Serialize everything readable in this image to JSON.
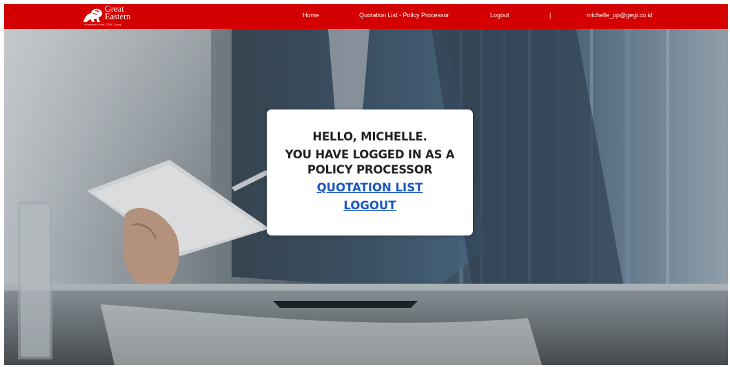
{
  "brand": {
    "logo_line1": "Great",
    "logo_line2": "Eastern",
    "logo_tagline": "A member of the OCBC Group"
  },
  "navbar": {
    "home_label": "Home",
    "quotation_label": "Quotation List - Policy Processor",
    "logout_label": "Logout",
    "separator": "|",
    "user_email": "michelle_pp@gegi.co.id"
  },
  "welcome_card": {
    "greeting": "HELLO, MICHELLE.",
    "role_line1": "YOU HAVE LOGGED IN AS A",
    "role_line2": "POLICY PROCESSOR",
    "quotation_link": "QUOTATION LIST",
    "logout_link": "LOGOUT"
  },
  "colors": {
    "navbar_bg": "#d40000",
    "link": "#1a56c4",
    "card_bg": "#ffffff"
  }
}
